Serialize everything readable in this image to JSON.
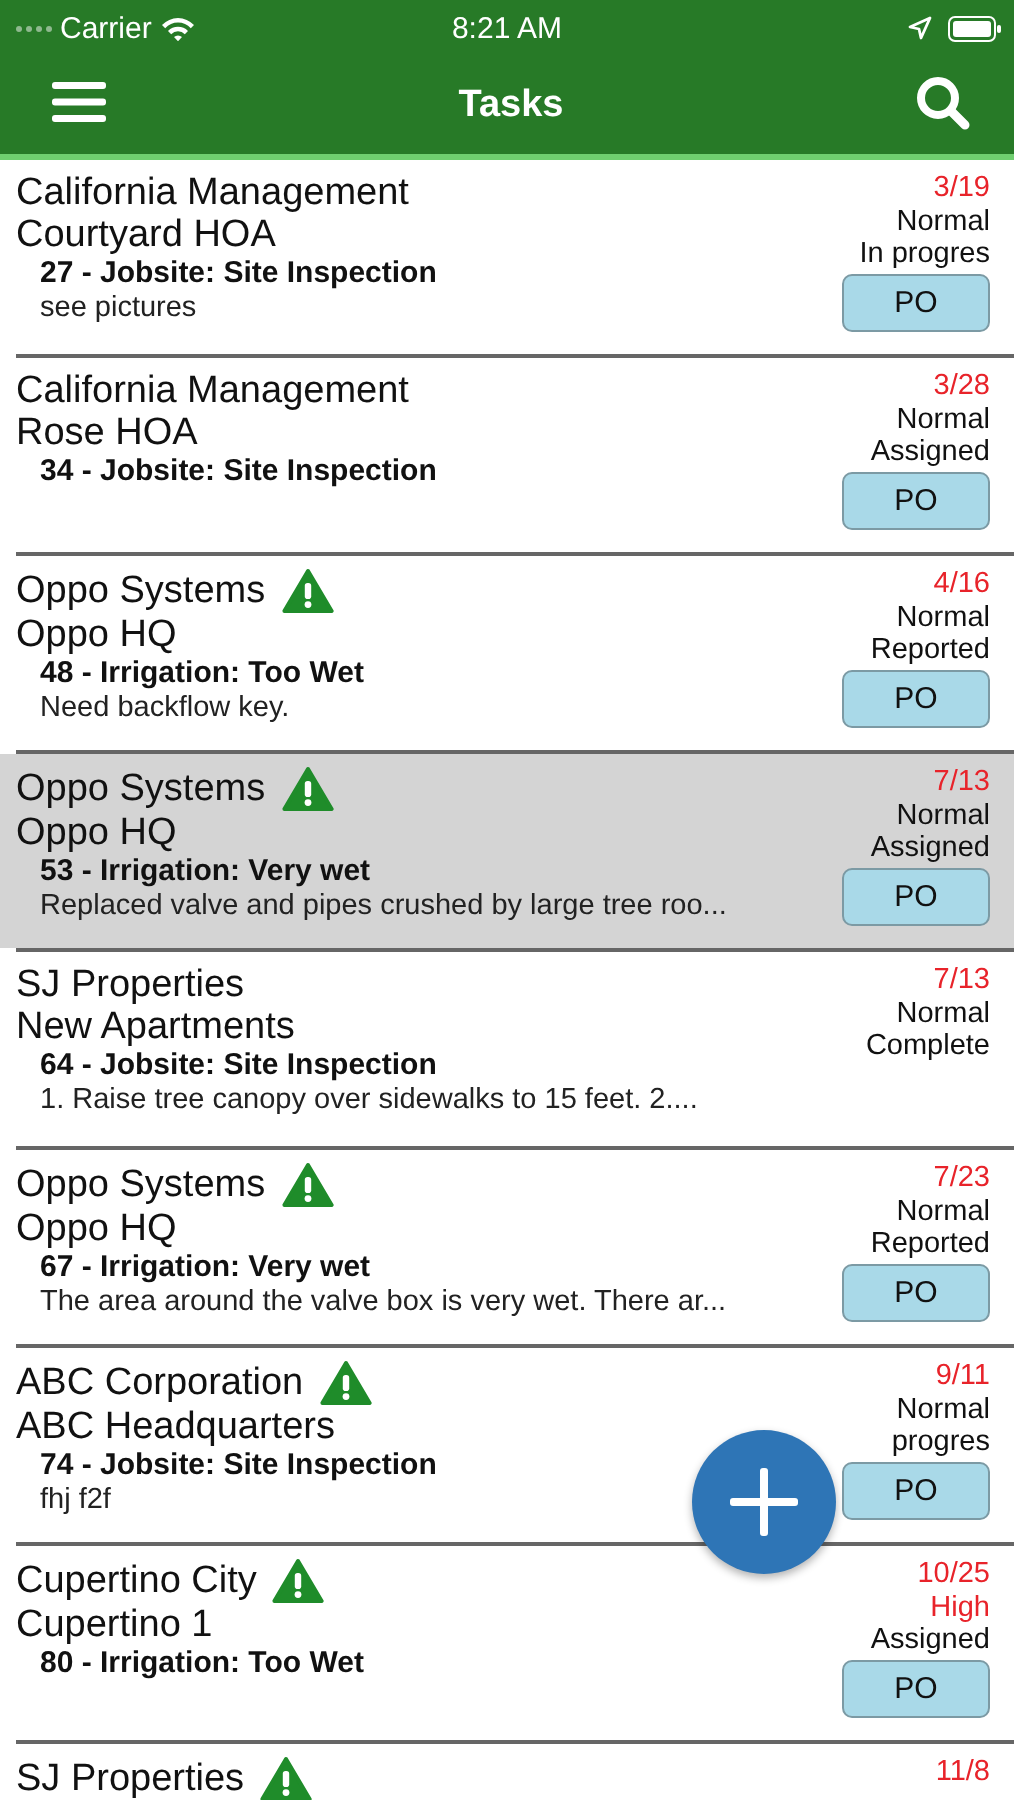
{
  "status_bar": {
    "carrier": "Carrier",
    "time": "8:21 AM"
  },
  "nav_bar": {
    "title": "Tasks"
  },
  "tasks": [
    {
      "company": "California Management",
      "site": "Courtyard HOA",
      "warning": false,
      "task": "27 - Jobsite: Site Inspection",
      "note": "see pictures",
      "date": "3/19",
      "priority": "Normal",
      "high_priority": false,
      "status": "In progres",
      "po": "PO",
      "selected": false
    },
    {
      "company": "California Management",
      "site": "Rose HOA",
      "warning": false,
      "task": "34 - Jobsite: Site Inspection",
      "date": "3/28",
      "priority": "Normal",
      "high_priority": false,
      "status": "Assigned",
      "po": "PO",
      "selected": false
    },
    {
      "company": "Oppo Systems",
      "site": "Oppo HQ",
      "warning": true,
      "task": "48 - Irrigation: Too Wet",
      "note": "Need backflow key.",
      "date": "4/16",
      "priority": "Normal",
      "high_priority": false,
      "status": "Reported",
      "po": "PO",
      "selected": false
    },
    {
      "company": "Oppo Systems",
      "site": "Oppo HQ",
      "warning": true,
      "task": "53 - Irrigation: Very wet",
      "note": "Replaced valve and pipes crushed by large tree roo...",
      "date": "7/13",
      "priority": "Normal",
      "high_priority": false,
      "status": "Assigned",
      "po": "PO",
      "selected": true
    },
    {
      "company": "SJ Properties",
      "site": "New Apartments",
      "warning": false,
      "task": "64 - Jobsite: Site Inspection",
      "note": "1.  Raise tree canopy over sidewalks to 15 feet.  2....",
      "date": "7/13",
      "priority": "Normal",
      "high_priority": false,
      "status": "Complete",
      "selected": false
    },
    {
      "company": "Oppo Systems",
      "site": "Oppo HQ",
      "warning": true,
      "task": "67 - Irrigation: Very wet",
      "note": "The area around the valve box is very wet.  There ar...",
      "date": "7/23",
      "priority": "Normal",
      "high_priority": false,
      "status": "Reported",
      "po": "PO",
      "selected": false
    },
    {
      "company": "ABC Corporation",
      "site": "ABC Headquarters",
      "warning": true,
      "task": "74 - Jobsite: Site Inspection",
      "note": "fhj f2f",
      "date": "9/11",
      "priority": "Normal",
      "high_priority": false,
      "status": "progres",
      "po": "PO",
      "selected": false
    },
    {
      "company": "Cupertino City",
      "site": "Cupertino 1",
      "warning": true,
      "task": "80 - Irrigation: Too Wet",
      "date": "10/25",
      "priority": "High",
      "high_priority": true,
      "status": "Assigned",
      "po": "PO",
      "selected": false
    },
    {
      "company": "SJ Properties",
      "warning": true,
      "date": "11/8",
      "selected": false
    }
  ]
}
